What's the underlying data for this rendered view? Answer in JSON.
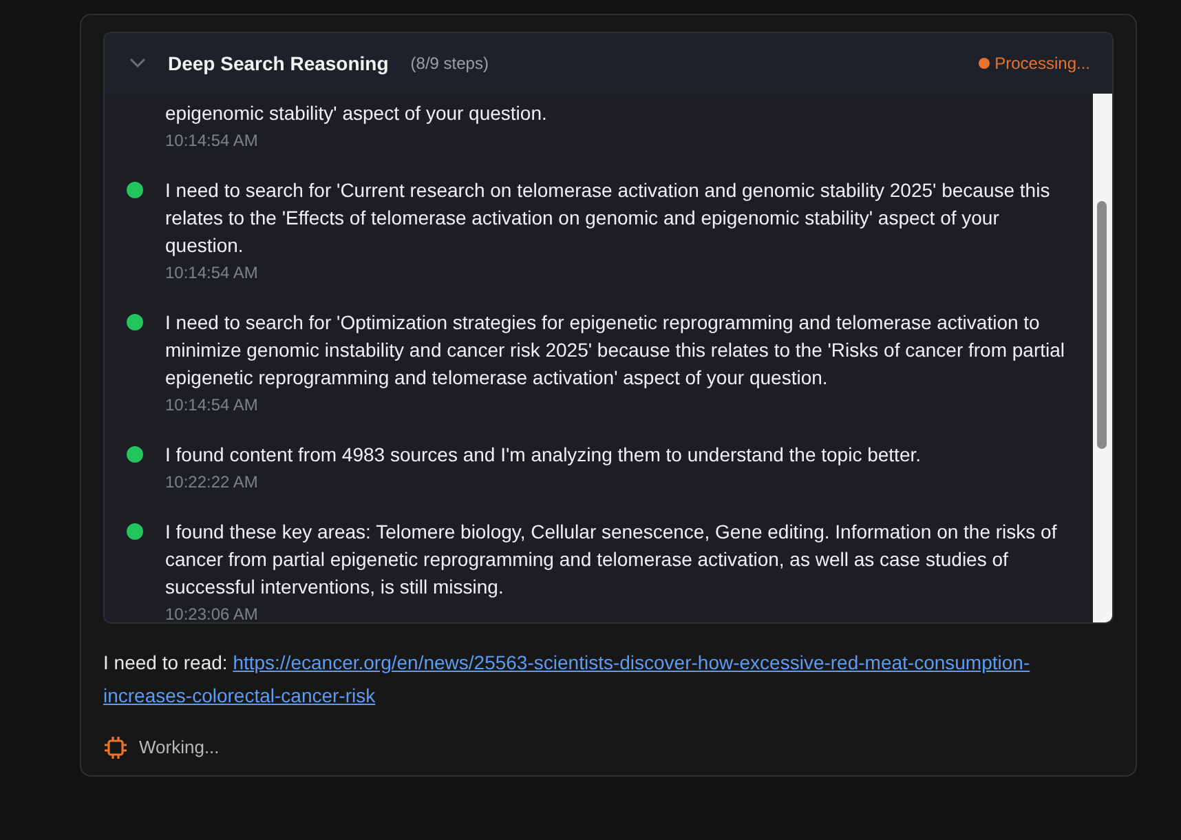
{
  "reasoning_panel": {
    "expanded": true,
    "title": "Deep Search Reasoning",
    "step_count": "(8/9 steps)",
    "status": "Processing...",
    "partial_step": {
      "text": "epigenomic stability' aspect of your question.",
      "time": "10:14:54 AM"
    },
    "steps": [
      {
        "text": "I need to search for 'Current research on telomerase activation and genomic stability 2025' because this relates to the 'Effects of telomerase activation on genomic and epigenomic stability' aspect of your question.",
        "time": "10:14:54 AM",
        "color": "#22c55e"
      },
      {
        "text": "I need to search for 'Optimization strategies for epigenetic reprogramming and telomerase activation to minimize genomic instability and cancer risk 2025' because this relates to the 'Risks of cancer from partial epigenetic reprogramming and telomerase activation' aspect of your question.",
        "time": "10:14:54 AM",
        "color": "#22c55e"
      },
      {
        "text": "I found content from 4983 sources and I'm analyzing them to understand the topic better.",
        "time": "10:22:22 AM",
        "color": "#22c55e"
      },
      {
        "text": "I found these key areas: Telomere biology, Cellular senescence, Gene editing. Information on the risks of cancer from partial epigenetic reprogramming and telomerase activation, as well as case studies of successful interventions, is still missing.",
        "time": "10:23:06 AM",
        "color": "#22c55e"
      }
    ]
  },
  "message": {
    "prefix": "I need to read:",
    "link_lines": [
      "https://ecancer.org/en/news/25563-scientists-discover-how-excessive-red-meat-consumption-",
      "increases-colorectal-cancer-risk"
    ]
  },
  "working_status": "Working..."
}
